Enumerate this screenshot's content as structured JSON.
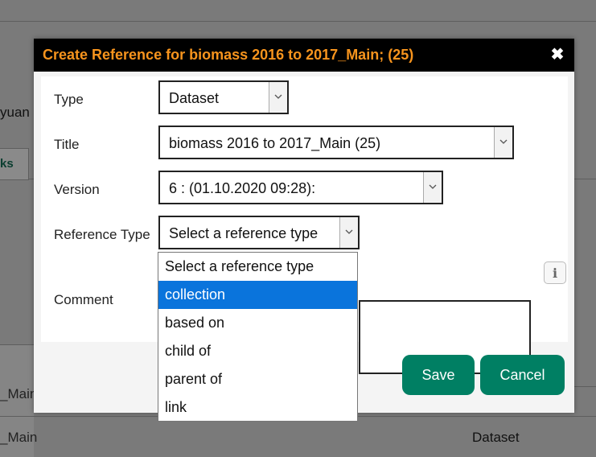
{
  "background": {
    "user_fragment": "yuan",
    "tab_fragment": "ks",
    "row1_fragment": "_Main",
    "row2_fragment": "_Main",
    "row2_type": "Dataset"
  },
  "dialog": {
    "title": "Create Reference for biomass 2016 to 2017_Main; (25)",
    "close_symbol": "✖",
    "fields": {
      "type": {
        "label": "Type",
        "value": "Dataset"
      },
      "title": {
        "label": "Title",
        "value": "biomass 2016 to 2017_Main (25)"
      },
      "version": {
        "label": "Version",
        "value": "6 : (01.10.2020 09:28):"
      },
      "reference_type": {
        "label": "Reference Type",
        "value": "Select a reference type"
      },
      "comment": {
        "label": "Comment",
        "value": ""
      }
    },
    "info_symbol": "i",
    "buttons": {
      "save": "Save",
      "cancel": "Cancel"
    }
  },
  "dropdown": {
    "options": [
      "Select a reference type",
      "collection",
      "based on",
      "child of",
      "parent of",
      "link"
    ],
    "highlighted": "collection"
  },
  "colors": {
    "title_text": "#f7941d",
    "button_bg": "#007f63",
    "highlight": "#0a74dc"
  }
}
